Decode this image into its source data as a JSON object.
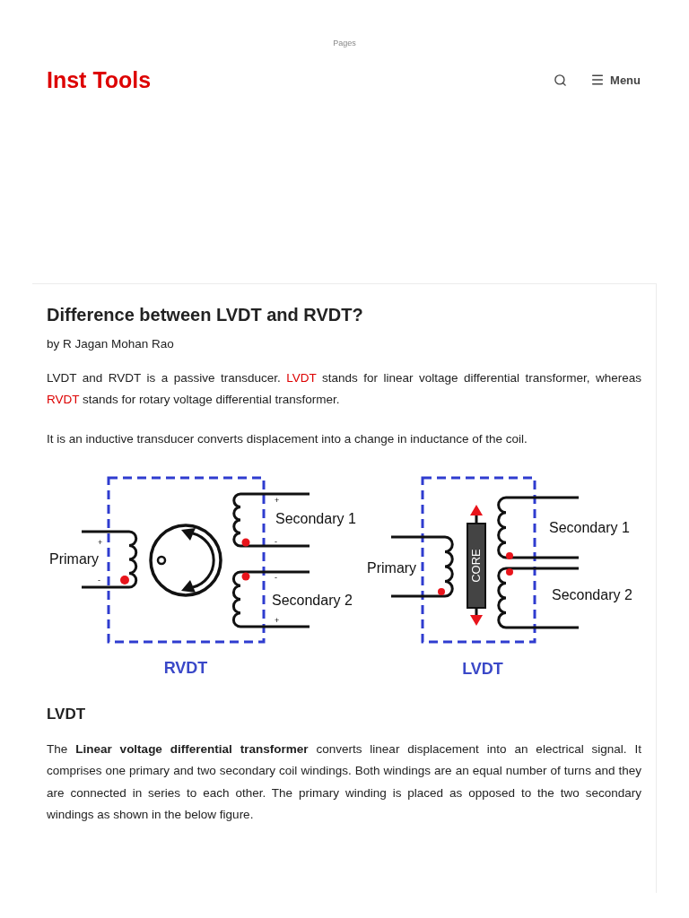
{
  "top_link": "Pages",
  "header": {
    "logo": "Inst Tools",
    "menu_label": "Menu"
  },
  "article": {
    "title": "Difference between LVDT and RVDT?",
    "byline": "by R Jagan Mohan Rao",
    "intro": [
      [
        {
          "kind": "text",
          "text": "LVDT and RVDT is a passive transducer. "
        },
        {
          "kind": "link",
          "text": "LVDT"
        },
        {
          "kind": "text",
          "text": " stands for linear voltage differential transformer, whereas "
        },
        {
          "kind": "link",
          "text": "RVDT"
        },
        {
          "kind": "text",
          "text": " stands for rotary voltage differential transformer."
        }
      ],
      [
        {
          "kind": "text",
          "text": "It is an inductive transducer converts displacement into a change in inductance of the coil."
        }
      ]
    ],
    "figure": {
      "rvdt": {
        "title": "RVDT",
        "primary": "Primary",
        "secondary_1": "Secondary 1",
        "secondary_2": "Secondary 2",
        "primary_marks": [
          "+",
          "-"
        ],
        "secondary_1_marks": [
          "+",
          "-"
        ],
        "secondary_2_marks": [
          "-",
          "+"
        ]
      },
      "lvdt": {
        "title": "LVDT",
        "primary": "Primary",
        "secondary_1": "Secondary 1",
        "secondary_2": "Secondary 2",
        "core": "CORE"
      }
    },
    "section": {
      "heading": "LVDT",
      "paragraph": "The **Linear voltage differential transformer** converts linear displacement into an electrical signal. It comprises one primary and two secondary coil windings. Both windings are an equal number of turns and they are connected in series to each other. The primary winding is placed as opposed to the two secondary windings as shown in the below figure."
    }
  }
}
